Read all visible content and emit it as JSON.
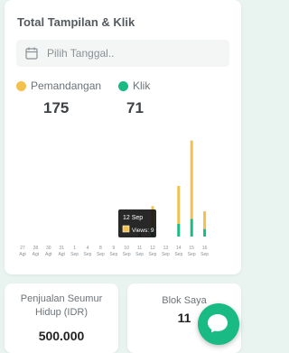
{
  "header": {
    "title": "Total Tampilan & Klik"
  },
  "date_filter": {
    "placeholder": "Pilih Tanggal.."
  },
  "legend": [
    {
      "label": "Pemandangan",
      "color": "#f2c14e",
      "value": "175"
    },
    {
      "label": "Klik",
      "color": "#1aba85",
      "value": "71"
    }
  ],
  "chart_data": {
    "type": "bar",
    "stacked": true,
    "categories": [
      "27 Agt",
      "28 Agt",
      "30 Agt",
      "31 Agt",
      "1 Sep",
      "4 Sep",
      "8 Sep",
      "9 Sep",
      "10 Sep",
      "11 Sep",
      "12 Sep",
      "13 Sep",
      "14 Sep",
      "15 Sep",
      "16 Sep"
    ],
    "tick_labels": [
      [
        "27",
        "Agt"
      ],
      [
        "28",
        "Agt"
      ],
      [
        "30",
        "Agt"
      ],
      [
        "31",
        "Agt"
      ],
      [
        "1",
        "Sep"
      ],
      [
        "4",
        "Sep"
      ],
      [
        "8",
        "Sep"
      ],
      [
        "9",
        "Sep"
      ],
      [
        "10",
        "Sep"
      ],
      [
        "11",
        "Sep"
      ],
      [
        "12",
        "Sep"
      ],
      [
        "13",
        "Sep"
      ],
      [
        "14",
        "Sep"
      ],
      [
        "15",
        "Sep"
      ],
      [
        "16",
        "Sep"
      ]
    ],
    "series": [
      {
        "name": "Klik",
        "color": "#1aba85",
        "values": [
          0,
          0,
          0,
          0,
          0,
          0,
          0,
          0,
          0,
          1,
          3,
          0,
          5,
          7,
          3
        ]
      },
      {
        "name": "Pemandangan",
        "color": "#f2c14e",
        "values": [
          0,
          0,
          0,
          0,
          0,
          0,
          0,
          0,
          0,
          2,
          9,
          0,
          15,
          31,
          7
        ]
      }
    ],
    "ylim": [
      0,
      40
    ],
    "tooltip": {
      "date": "12 Sep",
      "series": "Views",
      "value": "9",
      "category_index": 10
    }
  },
  "cards": [
    {
      "label": "Penjualan Seumur Hidup (IDR)",
      "value": "500.000"
    },
    {
      "label": "Blok Saya",
      "value": "11"
    }
  ],
  "fab": {
    "icon": "chat-icon"
  }
}
